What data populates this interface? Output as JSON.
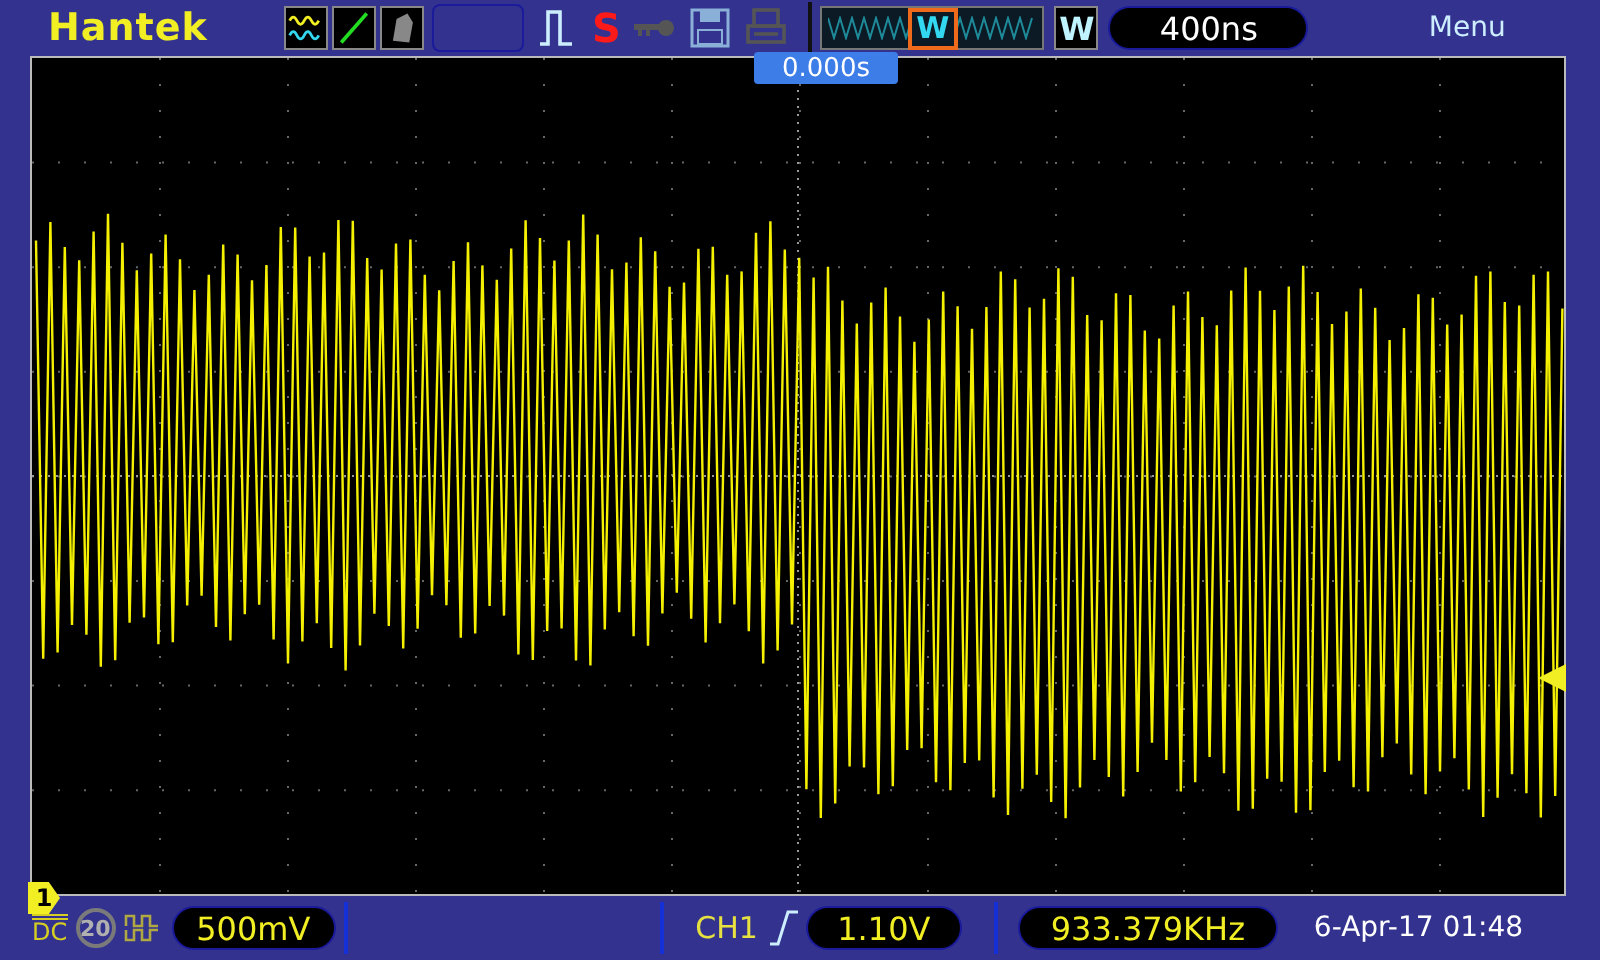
{
  "brand": "Hantek",
  "toolbar": {
    "run_state": "S",
    "key_locked": false,
    "printer_enabled": false
  },
  "overview": {
    "marker": "W"
  },
  "window_mode": "W",
  "timebase": "400ns",
  "menu": "Menu",
  "trigger_position": "0.000s",
  "channel_marker": "1",
  "channel": {
    "coupling": "DC",
    "bw_limit": {
      "label": "20",
      "on": false
    },
    "volts_per_div": "500mV"
  },
  "trigger": {
    "source": "CH1",
    "level": "1.10V"
  },
  "frequency": "933.379KHz",
  "datetime": "6-Apr-17 01:48"
}
